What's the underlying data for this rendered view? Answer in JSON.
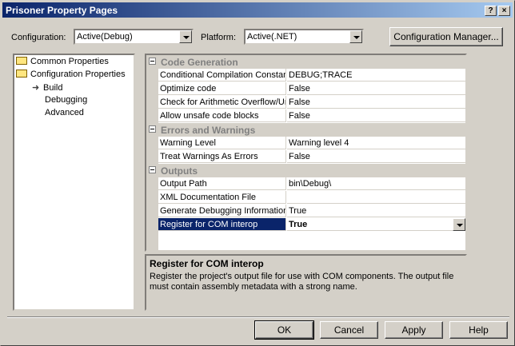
{
  "window": {
    "title": "Prisoner Property Pages"
  },
  "config": {
    "label": "Configuration:",
    "value": "Active(Debug)"
  },
  "platform": {
    "label": "Platform:",
    "value": "Active(.NET)"
  },
  "config_manager_label": "Configuration Manager...",
  "tree": {
    "items": [
      {
        "label": "Common Properties"
      },
      {
        "label": "Configuration Properties"
      },
      {
        "label": "Build"
      },
      {
        "label": "Debugging"
      },
      {
        "label": "Advanced"
      }
    ]
  },
  "grid": {
    "categories": [
      {
        "title": "Code Generation",
        "rows": [
          {
            "name": "Conditional Compilation Constants",
            "value": "DEBUG;TRACE"
          },
          {
            "name": "Optimize code",
            "value": "False"
          },
          {
            "name": "Check for Arithmetic Overflow/Underflow",
            "value": "False"
          },
          {
            "name": "Allow unsafe code blocks",
            "value": "False"
          }
        ]
      },
      {
        "title": "Errors and Warnings",
        "rows": [
          {
            "name": "Warning Level",
            "value": "Warning level 4"
          },
          {
            "name": "Treat Warnings As Errors",
            "value": "False"
          }
        ]
      },
      {
        "title": "Outputs",
        "rows": [
          {
            "name": "Output Path",
            "value": "bin\\Debug\\"
          },
          {
            "name": "XML Documentation File",
            "value": ""
          },
          {
            "name": "Generate Debugging Information",
            "value": "True"
          },
          {
            "name": "Register for COM interop",
            "value": "True"
          }
        ]
      }
    ]
  },
  "description": {
    "title": "Register for COM interop",
    "text": "Register the project's output file for use with COM components.  The output file must contain assembly metadata with a strong name."
  },
  "buttons": {
    "ok": "OK",
    "cancel": "Cancel",
    "apply": "Apply",
    "help": "Help"
  },
  "titlebar": {
    "help_glyph": "?",
    "close_glyph": "×"
  }
}
